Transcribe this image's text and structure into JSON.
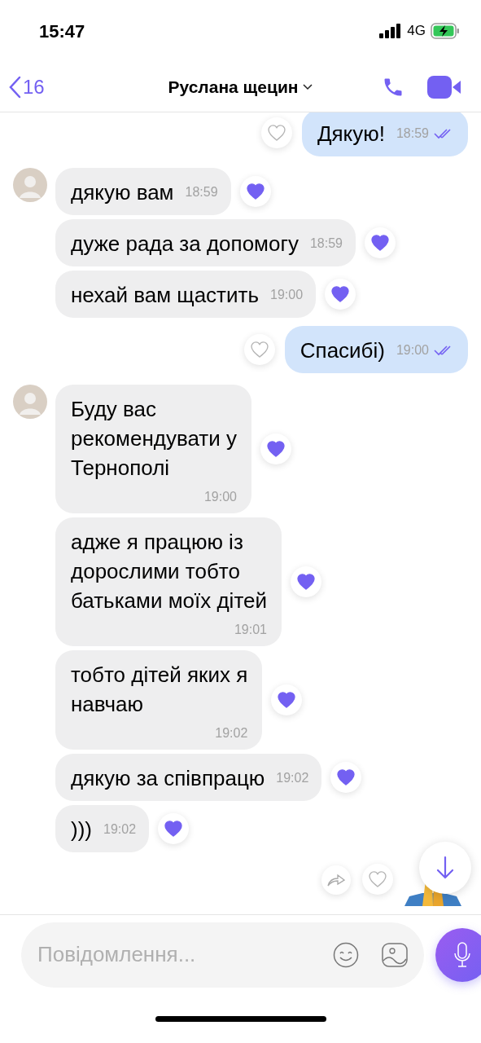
{
  "status_bar": {
    "time": "15:47",
    "network": "4G"
  },
  "header": {
    "back_count": "16",
    "title": "Руслана щецин"
  },
  "messages": [
    {
      "kind": "outgoing",
      "text": "Дякую!",
      "time": "18:59",
      "liked": false,
      "read": true
    },
    {
      "kind": "incoming",
      "avatar": true,
      "text": "дякую вам",
      "time": "18:59",
      "liked": true
    },
    {
      "kind": "incoming",
      "avatar": false,
      "text": "дуже рада за допомогу",
      "time": "18:59",
      "liked": true
    },
    {
      "kind": "incoming",
      "avatar": false,
      "text": "нехай вам щастить",
      "time": "19:00",
      "liked": true
    },
    {
      "kind": "outgoing",
      "text": "Спасибі)",
      "time": "19:00",
      "liked": false,
      "read": true
    },
    {
      "kind": "incoming",
      "avatar": true,
      "text": "Буду вас\nрекомендувати у\nТернополі",
      "time": "19:00",
      "liked": true
    },
    {
      "kind": "incoming",
      "avatar": false,
      "text": "адже я працюю із\nдорослими тобто\nбатьками моїх дітей",
      "time": "19:01",
      "liked": true
    },
    {
      "kind": "incoming",
      "avatar": false,
      "text": "тобто дітей яких я\nнавчаю",
      "time": "19:02",
      "liked": true
    },
    {
      "kind": "incoming",
      "avatar": false,
      "text": "дякую за співпрацю",
      "time": "19:02",
      "liked": true
    },
    {
      "kind": "incoming",
      "avatar": false,
      "text": ")))",
      "time": "19:02",
      "liked": true
    },
    {
      "kind": "sticker",
      "liked": false
    }
  ],
  "composer": {
    "placeholder": "Повідомлення..."
  }
}
